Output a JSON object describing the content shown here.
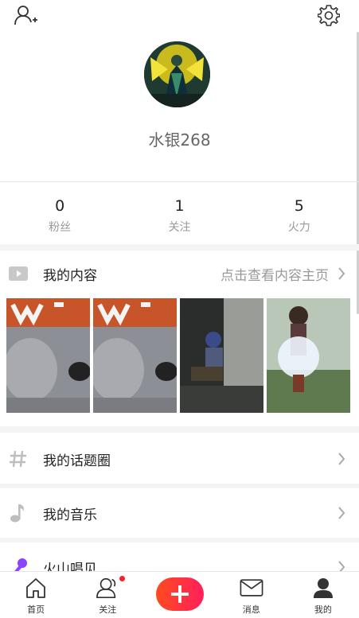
{
  "header": {
    "add_friend_icon": "person-plus-icon",
    "settings_icon": "gear-icon"
  },
  "profile": {
    "username": "水银268"
  },
  "stats": [
    {
      "value": "0",
      "label": "粉丝"
    },
    {
      "value": "1",
      "label": "关注"
    },
    {
      "value": "5",
      "label": "火力"
    }
  ],
  "content_section": {
    "title": "我的内容",
    "link": "点击查看内容主页",
    "thumbnails": [
      {
        "name": "video-thumbnail-1"
      },
      {
        "name": "video-thumbnail-2"
      },
      {
        "name": "video-thumbnail-3"
      },
      {
        "name": "video-thumbnail-4"
      }
    ]
  },
  "menu": [
    {
      "label": "我的话题圈",
      "icon": "hashtag-icon"
    },
    {
      "label": "我的音乐",
      "icon": "music-note-icon"
    },
    {
      "label": "火山唱见",
      "icon": "microphone-icon"
    }
  ],
  "bottom_nav": [
    {
      "label": "首页",
      "icon": "home-icon"
    },
    {
      "label": "关注",
      "icon": "people-icon",
      "badge": true
    },
    {
      "label": "",
      "icon": "plus-icon"
    },
    {
      "label": "消息",
      "icon": "mail-icon"
    },
    {
      "label": "我的",
      "icon": "user-icon"
    }
  ],
  "colors": {
    "accent": "#ff2d3d",
    "badge": "#f5222d",
    "mic": "#8e44ff"
  }
}
